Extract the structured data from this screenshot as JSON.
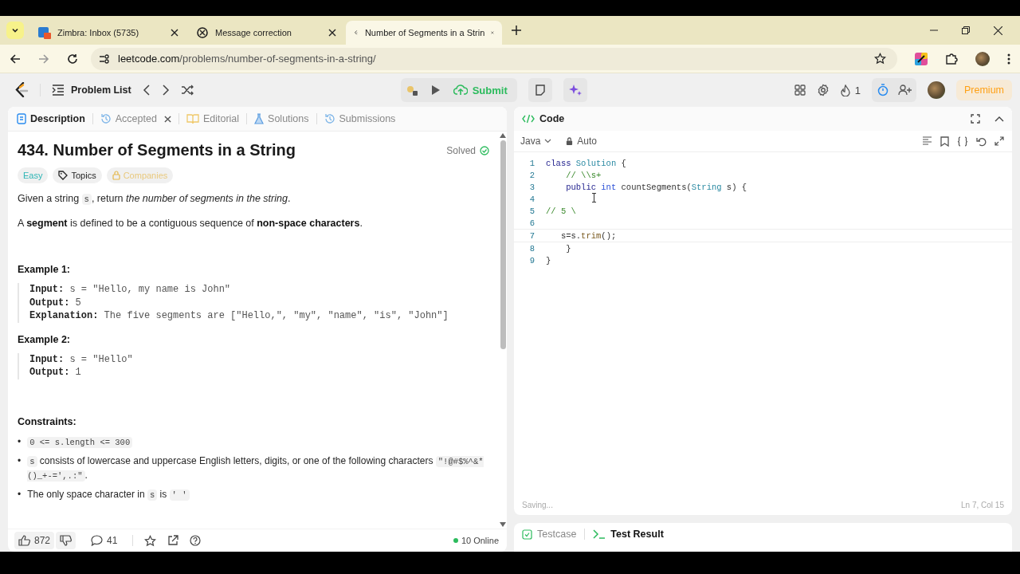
{
  "browser": {
    "tabs": [
      {
        "title": "Zimbra: Inbox (5735)",
        "selected": false
      },
      {
        "title": "Message correction",
        "selected": false
      },
      {
        "title": "Number of Segments in a Strin",
        "selected": true
      }
    ],
    "url_host": "leetcode.com",
    "url_path": "/problems/number-of-segments-in-a-string/"
  },
  "header": {
    "problem_list": "Problem List",
    "submit": "Submit",
    "streak": "1",
    "premium": "Premium"
  },
  "left": {
    "tabs": [
      {
        "label": "Description",
        "selected": true,
        "closable": false
      },
      {
        "label": "Accepted",
        "selected": false,
        "closable": true
      },
      {
        "label": "Editorial",
        "selected": false,
        "closable": false
      },
      {
        "label": "Solutions",
        "selected": false,
        "closable": false
      },
      {
        "label": "Submissions",
        "selected": false,
        "closable": false
      }
    ],
    "title": "434. Number of Segments in a String",
    "status": "Solved",
    "tags": [
      {
        "label": "Easy",
        "kind": "difficulty"
      },
      {
        "label": "Topics",
        "kind": "topics"
      },
      {
        "label": "Companies",
        "kind": "locked"
      }
    ],
    "paragraphs": [
      [
        {
          "text": "Given a string ",
          "kind": "plain"
        },
        {
          "text": "s",
          "kind": "code"
        },
        {
          "text": ", return ",
          "kind": "plain"
        },
        {
          "text": "the number of segments in the string",
          "kind": "italic"
        },
        {
          "text": ".",
          "kind": "plain"
        }
      ],
      [
        {
          "text": "A ",
          "kind": "plain"
        },
        {
          "text": "segment",
          "kind": "bold"
        },
        {
          "text": " is defined to be a contiguous sequence of ",
          "kind": "plain"
        },
        {
          "text": "non-space characters",
          "kind": "bold"
        },
        {
          "text": ".",
          "kind": "plain"
        }
      ]
    ],
    "examples": [
      {
        "title": "Example 1:",
        "lines": [
          {
            "label": "Input:",
            "value": "s = \"Hello, my name is John\""
          },
          {
            "label": "Output:",
            "value": "5"
          },
          {
            "label": "Explanation:",
            "value": "The five segments are [\"Hello,\", \"my\", \"name\", \"is\", \"John\"]"
          }
        ]
      },
      {
        "title": "Example 2:",
        "lines": [
          {
            "label": "Input:",
            "value": "s = \"Hello\""
          },
          {
            "label": "Output:",
            "value": "1"
          }
        ]
      }
    ],
    "constraints_title": "Constraints:",
    "constraints": [
      {
        "bullet": "•",
        "parts": [
          {
            "text": "0 <= s.length <= 300",
            "kind": "code"
          }
        ]
      },
      {
        "bullet": "•",
        "parts": [
          {
            "text": "s",
            "kind": "code"
          },
          {
            "text": " consists of lowercase and uppercase English letters, digits, or one of the following characters ",
            "kind": "plain"
          },
          {
            "text": "\"!@#$%^&*()_+-=',.:\"",
            "kind": "code"
          },
          {
            "text": ".",
            "kind": "plain"
          }
        ]
      },
      {
        "bullet": "•",
        "parts": [
          {
            "text": "The only space character in ",
            "kind": "plain"
          },
          {
            "text": "s",
            "kind": "code"
          },
          {
            "text": " is ",
            "kind": "plain"
          },
          {
            "text": "' '",
            "kind": "code"
          }
        ]
      }
    ],
    "likes": "872",
    "comments": "41",
    "online": "10 Online"
  },
  "right": {
    "title": "Code",
    "language": "Java",
    "mode": "Auto",
    "lines": [
      {
        "number": "1",
        "current": false,
        "tokens": [
          {
            "text": "class",
            "kind": "keyword"
          },
          {
            "text": " Solution",
            "kind": "type"
          },
          {
            "text": " {",
            "kind": "plain"
          }
        ]
      },
      {
        "number": "2",
        "current": false,
        "tokens": [
          {
            "text": "    // \\\\s+",
            "kind": "comment"
          }
        ]
      },
      {
        "number": "3",
        "current": false,
        "tokens": [
          {
            "text": "    public",
            "kind": "keyword"
          },
          {
            "text": " int",
            "kind": "primitive"
          },
          {
            "text": " countSegments(",
            "kind": "plain"
          },
          {
            "text": "String",
            "kind": "type"
          },
          {
            "text": " s) {",
            "kind": "plain"
          }
        ]
      },
      {
        "number": "4",
        "current": false
      },
      {
        "number": "5",
        "current": false,
        "tokens": [
          {
            "text": "// 5 \\",
            "kind": "comment"
          }
        ]
      },
      {
        "number": "6",
        "current": false
      },
      {
        "number": "7",
        "current": true,
        "tokens": [
          {
            "text": "   s=s.",
            "kind": "plain"
          },
          {
            "text": "trim",
            "kind": "function"
          },
          {
            "text": "();",
            "kind": "plain"
          }
        ]
      },
      {
        "number": "8",
        "current": false,
        "tokens": [
          {
            "text": "    }",
            "kind": "plain"
          }
        ]
      },
      {
        "number": "9",
        "current": false,
        "tokens": [
          {
            "text": "}",
            "kind": "plain"
          }
        ]
      }
    ],
    "save_status": "Saving...",
    "position": "Ln 7, Col 15",
    "bottom_tabs": [
      {
        "label": "Testcase",
        "selected": false
      },
      {
        "label": "Test Result",
        "selected": true
      }
    ]
  }
}
